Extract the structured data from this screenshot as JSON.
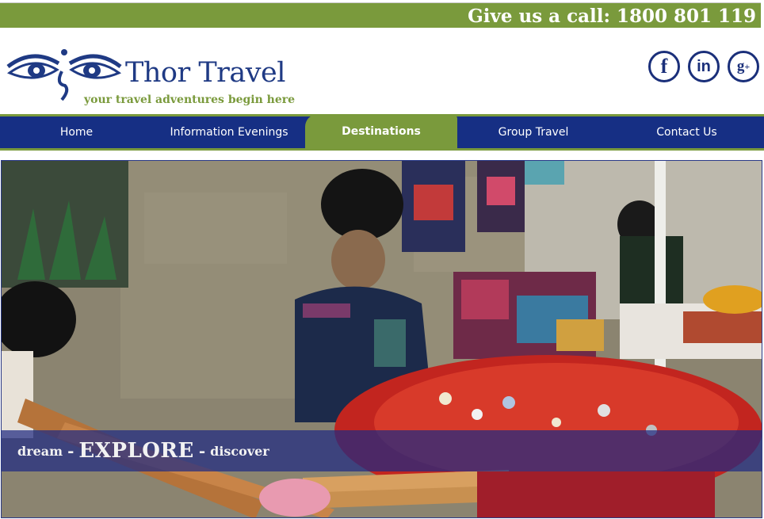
{
  "topbar": {
    "call_text": "Give us a call: 1800 801 119"
  },
  "brand": {
    "name": "Thor Travel",
    "tagline": "your travel adventures begin here",
    "primary_color": "#1f3a84",
    "accent_color": "#7a9a3c"
  },
  "social": [
    {
      "icon": "facebook-icon",
      "glyph": "f"
    },
    {
      "icon": "linkedin-icon",
      "glyph": "in"
    },
    {
      "icon": "google-plus-icon",
      "glyph": "g"
    }
  ],
  "nav": {
    "items": [
      {
        "label": "Home"
      },
      {
        "label": "Information Evenings"
      },
      {
        "label": "Destinations",
        "active": true
      },
      {
        "label": "Group Travel"
      },
      {
        "label": "Contact Us"
      }
    ]
  },
  "hero": {
    "caption_dream": "dream",
    "caption_dash1": "-",
    "caption_explore": "EXPLORE",
    "caption_dash2": "-",
    "caption_discover": "discover"
  }
}
